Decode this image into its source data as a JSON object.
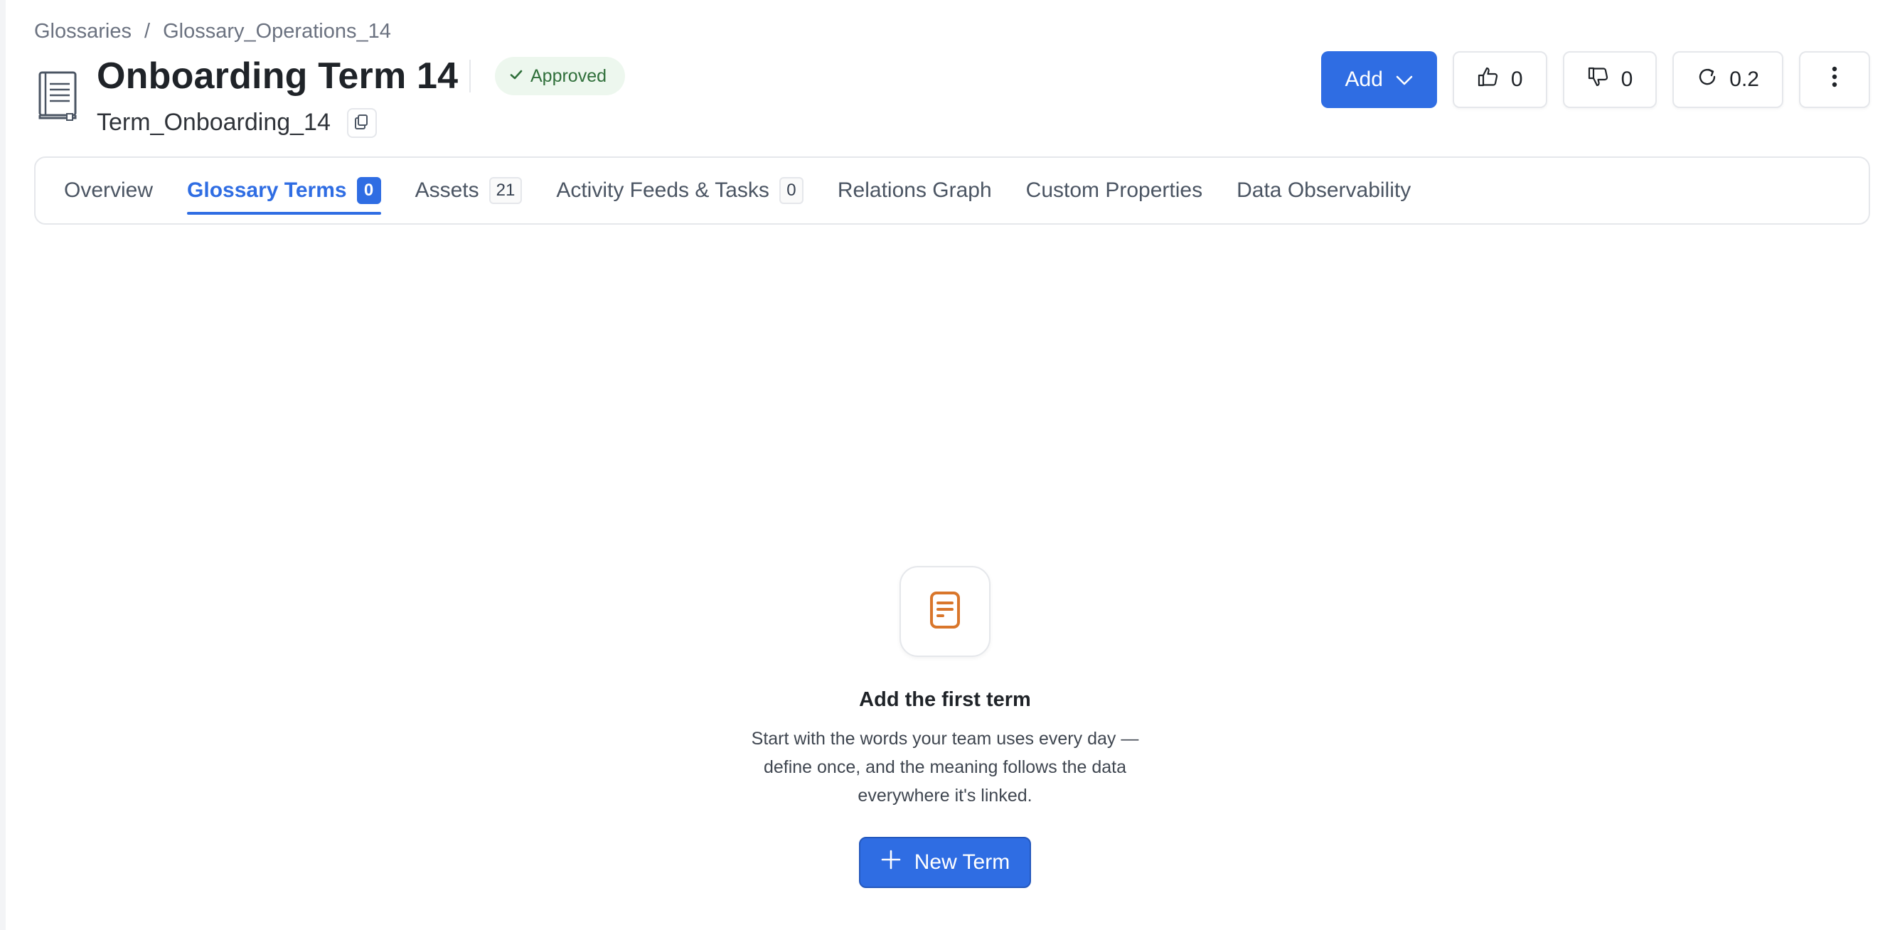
{
  "breadcrumb": {
    "items": [
      "Glossaries",
      "Glossary_Operations_14"
    ],
    "separator": "/"
  },
  "header": {
    "title": "Onboarding Term 14",
    "subtitle": "Term_Onboarding_14",
    "status": "Approved",
    "icon": "book-icon"
  },
  "actions": {
    "add_label": "Add",
    "upvotes": "0",
    "downvotes": "0",
    "version": "0.2"
  },
  "tabs": [
    {
      "label": "Overview",
      "count": null
    },
    {
      "label": "Glossary Terms",
      "count": "0"
    },
    {
      "label": "Assets",
      "count": "21"
    },
    {
      "label": "Activity Feeds & Tasks",
      "count": "0"
    },
    {
      "label": "Relations Graph",
      "count": null
    },
    {
      "label": "Custom Properties",
      "count": null
    },
    {
      "label": "Data Observability",
      "count": null
    }
  ],
  "active_tab": "Glossary Terms",
  "empty_state": {
    "icon": "document-icon",
    "title": "Add the first term",
    "description": "Start with the words your team uses every day — define once, and the meaning follows the data everywhere it's linked.",
    "button_label": "New Term"
  },
  "colors": {
    "primary": "#2f6de3",
    "status_bg": "#edf7ee",
    "status_text": "#2f6f3a",
    "empty_icon": "#d9762b"
  }
}
